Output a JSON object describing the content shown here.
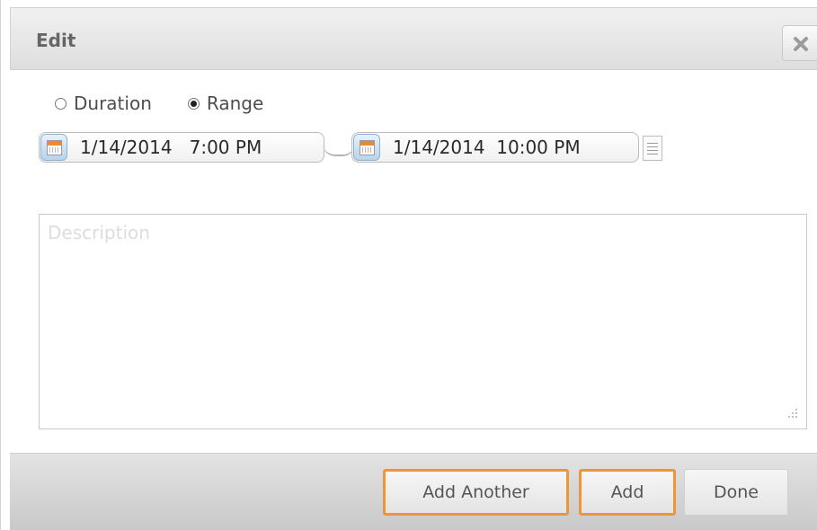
{
  "dialog": {
    "title": "Edit",
    "close_icon": "close-x-icon"
  },
  "mode": {
    "options": [
      {
        "label": "Duration",
        "selected": false
      },
      {
        "label": "Range",
        "selected": true
      }
    ]
  },
  "range": {
    "start": "1/14/2014   7:00 PM",
    "end": "1/14/2014  10:00 PM",
    "calendar_icon": "calendar-icon",
    "options_icon": "list-icon"
  },
  "description": {
    "value": "",
    "placeholder": "Description"
  },
  "footer": {
    "add_another_label": "Add Another",
    "add_label": "Add",
    "done_label": "Done"
  },
  "colors": {
    "highlight": "#f0943a",
    "calendar_accent": "#e88a2d"
  }
}
